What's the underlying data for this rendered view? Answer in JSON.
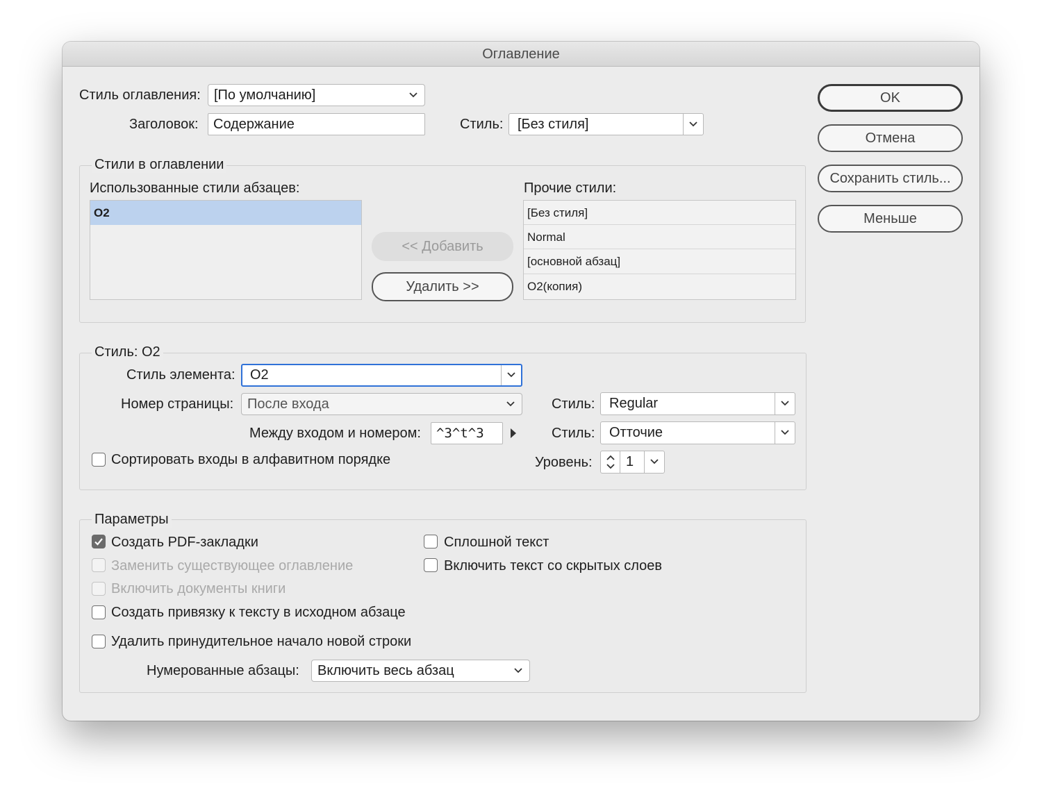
{
  "window": {
    "title": "Оглавление"
  },
  "top": {
    "toc_style_label": "Стиль оглавления:",
    "toc_style_value": "[По умолчанию]",
    "heading_label": "Заголовок:",
    "heading_value": "Содержание",
    "heading_style_label": "Стиль:",
    "heading_style_value": "[Без стиля]"
  },
  "buttons": {
    "ok": "OK",
    "cancel": "Отмена",
    "save_style": "Сохранить стиль...",
    "less": "Меньше"
  },
  "styles_group": {
    "legend": "Стили в оглавлении",
    "used_label": "Использованные стили абзацев:",
    "used_items": [
      "O2"
    ],
    "add_button": "<< Добавить",
    "remove_button": "Удалить >>",
    "other_label": "Прочие стили:",
    "other_items": [
      "[Без стиля]",
      "Normal",
      "[основной абзац]",
      "O2(копия)"
    ]
  },
  "style_group": {
    "legend": "Стиль: O2",
    "entry_style_label": "Стиль элемента:",
    "entry_style_value": "O2",
    "page_number_label": "Номер страницы:",
    "page_number_value": "После входа",
    "pn_style_label": "Стиль:",
    "pn_style_value": "Regular",
    "between_label": "Между входом и номером:",
    "between_value": "^3^t^3",
    "between_style_label": "Стиль:",
    "between_style_value": "Отточие",
    "sort_label": "Сортировать входы в алфавитном порядке",
    "sort_checked": false,
    "level_label": "Уровень:",
    "level_value": "1"
  },
  "options_group": {
    "legend": "Параметры",
    "pdf_bookmarks": {
      "label": "Создать PDF-закладки",
      "checked": true,
      "enabled": true
    },
    "replace_toc": {
      "label": "Заменить существующее оглавление",
      "checked": false,
      "enabled": false
    },
    "include_book": {
      "label": "Включить документы книги",
      "checked": false,
      "enabled": false
    },
    "anchor": {
      "label": "Создать привязку к тексту в исходном абзаце",
      "checked": false,
      "enabled": true
    },
    "remove_breaks": {
      "label": "Удалить принудительное начало новой строки",
      "checked": false,
      "enabled": true
    },
    "run_in": {
      "label": "Сплошной текст",
      "checked": false,
      "enabled": true
    },
    "hidden_layers": {
      "label": "Включить текст со скрытых слоев",
      "checked": false,
      "enabled": true
    },
    "numbered_label": "Нумерованные абзацы:",
    "numbered_value": "Включить весь абзац"
  },
  "colors": {
    "accent": "#2f71d8",
    "selection": "#bcd2ee"
  }
}
